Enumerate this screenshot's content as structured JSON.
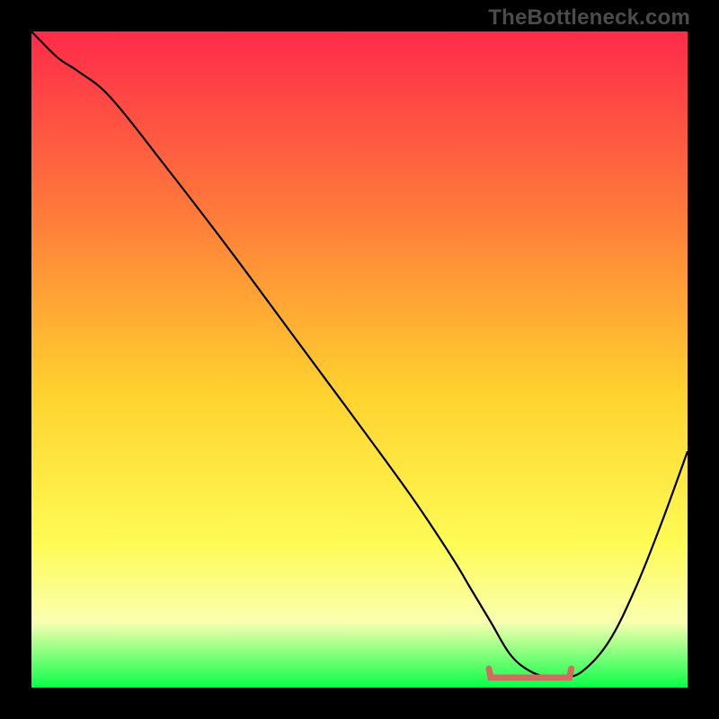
{
  "watermark": "TheBottleneck.com",
  "colors": {
    "frame": "#000000",
    "gradient_top": "#ff2a4a",
    "gradient_mid1": "#ff7b3a",
    "gradient_mid2": "#ffd22e",
    "gradient_mid3": "#fffb55",
    "gradient_mid4": "#faffb0",
    "gradient_bottom": "#09ff47",
    "curve": "#000000",
    "trough": "#d66a62"
  },
  "chart_data": {
    "type": "line",
    "title": "",
    "xlabel": "",
    "ylabel": "",
    "xlim": [
      0,
      100
    ],
    "ylim": [
      0,
      100
    ],
    "series": [
      {
        "name": "bottleneck-curve",
        "x": [
          0,
          4,
          7,
          12,
          20,
          30,
          40,
          50,
          58,
          64,
          67,
          70,
          73,
          76,
          79,
          81,
          84,
          88,
          92,
          96,
          100
        ],
        "values": [
          100,
          96,
          94,
          90,
          80,
          67,
          53.5,
          40,
          29,
          20,
          15,
          10,
          5,
          2.5,
          1.5,
          1.5,
          2.5,
          7,
          15,
          25,
          36
        ]
      }
    ],
    "annotations": [
      {
        "name": "trough-marker",
        "x_range": [
          70,
          82
        ],
        "y": 1.5
      }
    ]
  }
}
